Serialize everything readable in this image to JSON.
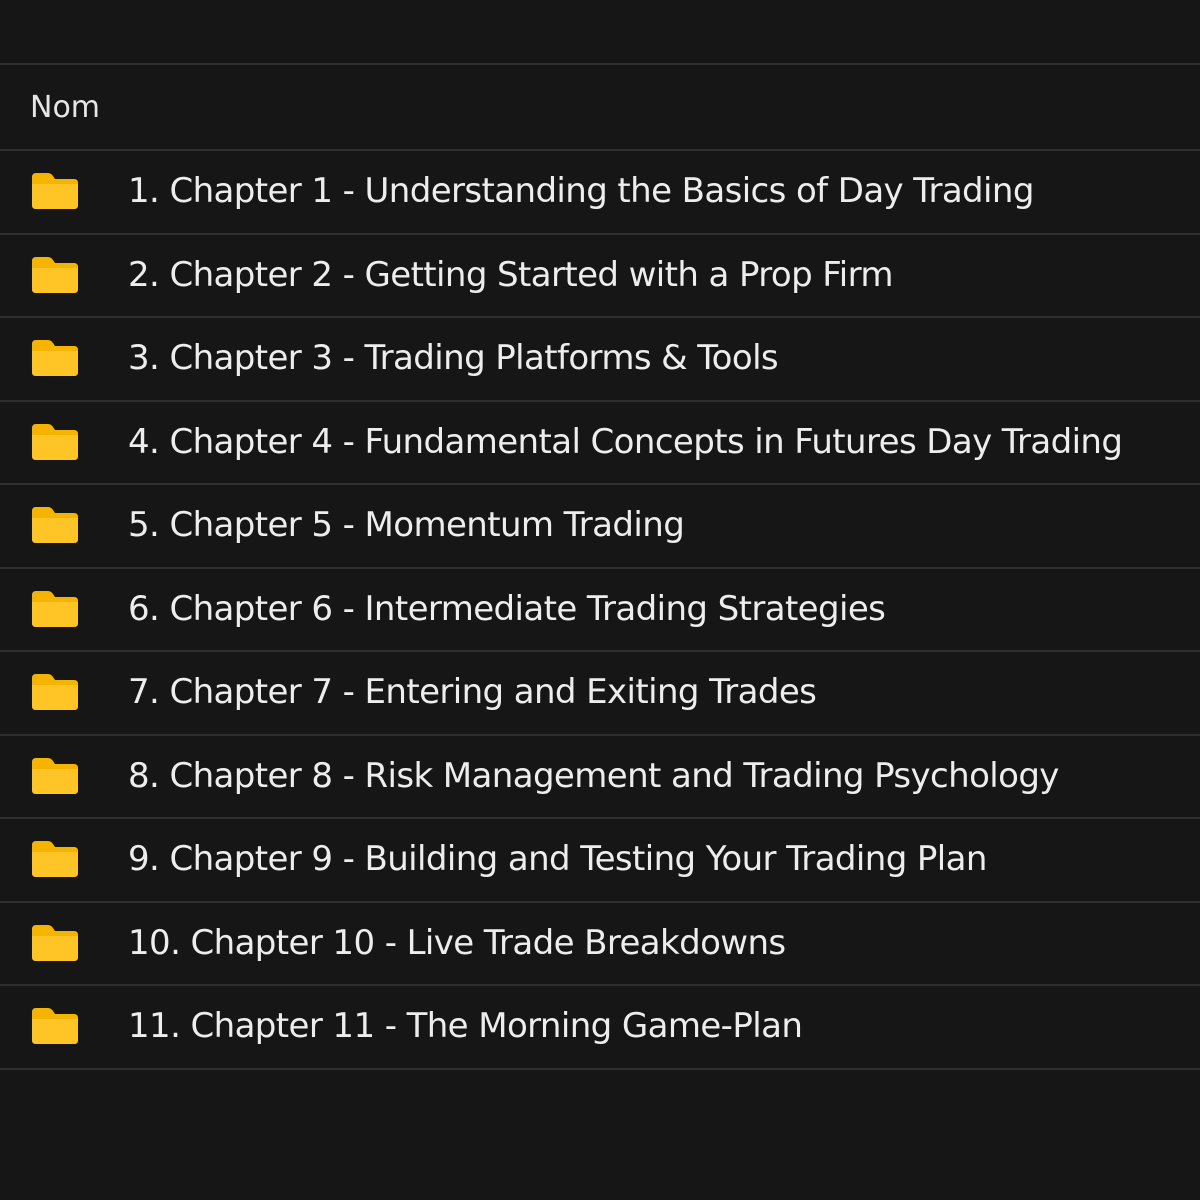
{
  "header": {
    "name_column_label": "Nom"
  },
  "colors": {
    "background": "#161616",
    "divider": "#2e2e2e",
    "folder": "#f5b400",
    "text": "#ededed"
  },
  "folders": [
    {
      "icon": "folder-icon",
      "label": "1. Chapter 1 - Understanding the Basics of Day Trading"
    },
    {
      "icon": "folder-icon",
      "label": "2. Chapter 2 - Getting Started with a Prop Firm"
    },
    {
      "icon": "folder-icon",
      "label": "3. Chapter 3 - Trading Platforms & Tools"
    },
    {
      "icon": "folder-icon",
      "label": "4. Chapter 4 - Fundamental Concepts in Futures Day Trading"
    },
    {
      "icon": "folder-icon",
      "label": "5. Chapter 5 - Momentum Trading"
    },
    {
      "icon": "folder-icon",
      "label": "6. Chapter 6 - Intermediate Trading Strategies"
    },
    {
      "icon": "folder-icon",
      "label": "7. Chapter 7 - Entering and Exiting Trades"
    },
    {
      "icon": "folder-icon",
      "label": "8. Chapter 8 - Risk Management and Trading Psychology"
    },
    {
      "icon": "folder-icon",
      "label": "9. Chapter 9 - Building and Testing Your Trading Plan"
    },
    {
      "icon": "folder-icon",
      "label": "10. Chapter 10 - Live Trade Breakdowns"
    },
    {
      "icon": "folder-icon",
      "label": "11. Chapter 11 - The Morning Game-Plan"
    }
  ]
}
